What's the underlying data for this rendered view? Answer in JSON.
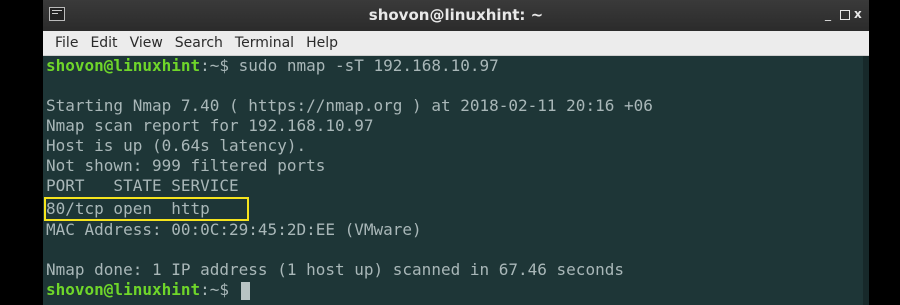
{
  "window": {
    "title": "shovon@linuxhint: ~",
    "controls": {
      "minimize": "_",
      "close": "x"
    }
  },
  "menubar": {
    "items": [
      "File",
      "Edit",
      "View",
      "Search",
      "Terminal",
      "Help"
    ]
  },
  "terminal": {
    "prompt1": {
      "user": "shovon@linuxhint",
      "sep": ":~$",
      "command": " sudo nmap -sT 192.168.10.97"
    },
    "lines": [
      "Starting Nmap 7.40 ( https://nmap.org ) at 2018-02-11 20:16 +06",
      "Nmap scan report for 192.168.10.97",
      "Host is up (0.64s latency).",
      "Not shown: 999 filtered ports",
      "PORT   STATE SERVICE",
      "80/tcp open  http",
      "MAC Address: 00:0C:29:45:2D:EE (VMware)",
      "",
      "Nmap done: 1 IP address (1 host up) scanned in 67.46 seconds"
    ],
    "prompt2": {
      "user": "shovon@linuxhint",
      "sep": ":~$",
      "command": " "
    }
  },
  "colors": {
    "terminal_bg": "#1e3637",
    "prompt_user": "#6fd62a",
    "highlight_box": "#f5e41e"
  }
}
